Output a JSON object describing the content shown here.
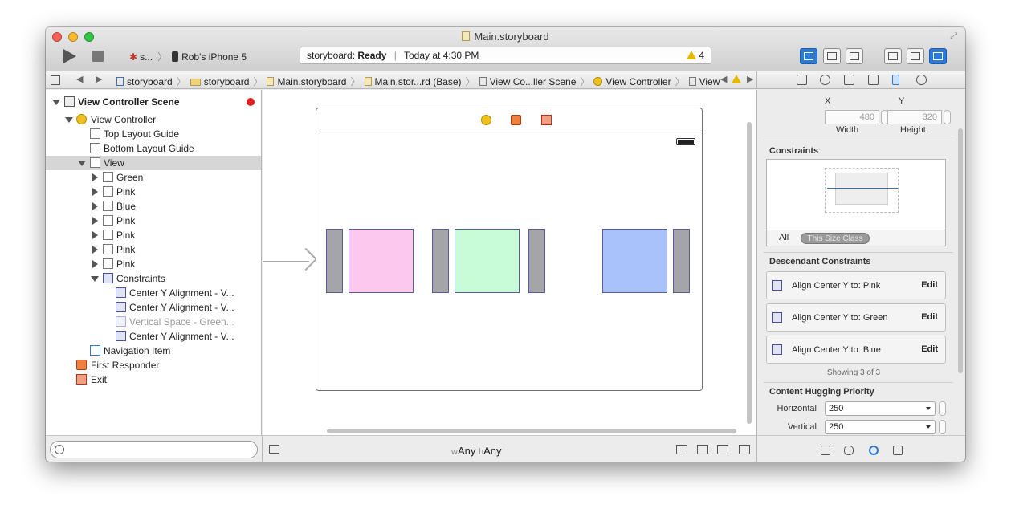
{
  "window": {
    "title": "Main.storyboard"
  },
  "toolbar": {
    "scheme_app": "s...",
    "scheme_device": "Rob's iPhone 5",
    "activity_prefix": "storyboard:",
    "activity_status": "Ready",
    "activity_time": "Today at 4:30 PM",
    "warning_count": "4"
  },
  "jumpbar": {
    "crumbs": [
      "storyboard",
      "storyboard",
      "Main.storyboard",
      "Main.stor...rd (Base)",
      "View Co...ller Scene",
      "View Controller",
      "View"
    ]
  },
  "outline": {
    "rows": [
      {
        "label": "View Controller Scene"
      },
      {
        "label": "View Controller"
      },
      {
        "label": "Top Layout Guide"
      },
      {
        "label": "Bottom Layout Guide"
      },
      {
        "label": "View"
      },
      {
        "label": "Green"
      },
      {
        "label": "Pink"
      },
      {
        "label": "Blue"
      },
      {
        "label": "Pink"
      },
      {
        "label": "Pink"
      },
      {
        "label": "Pink"
      },
      {
        "label": "Pink"
      },
      {
        "label": "Constraints"
      },
      {
        "label": "Center Y Alignment - V..."
      },
      {
        "label": "Center Y Alignment - V..."
      },
      {
        "label": "Vertical Space - Green..."
      },
      {
        "label": "Center Y Alignment - V..."
      },
      {
        "label": "Navigation Item"
      },
      {
        "label": "First Responder"
      },
      {
        "label": "Exit"
      }
    ]
  },
  "canvas": {
    "size_class_w": "w",
    "size_class_w_value": "Any",
    "size_class_h": "h",
    "size_class_h_value": "Any"
  },
  "colors": {
    "pink": "#fdc8ee",
    "green": "#c8fcd9",
    "blue": "#a9c2fb",
    "gray": "#a5a5a9"
  },
  "inspector": {
    "x_label": "X",
    "y_label": "Y",
    "width_value": "480",
    "height_value": "320",
    "width_label": "Width",
    "height_label": "Height",
    "constraints_title": "Constraints",
    "all_label": "All",
    "size_class_pill": "This Size Class",
    "descendant_title": "Descendant Constraints",
    "descendant": [
      {
        "text": "Align Center Y to:  Pink",
        "edit": "Edit"
      },
      {
        "text": "Align Center Y to:  Green",
        "edit": "Edit"
      },
      {
        "text": "Align Center Y to:  Blue",
        "edit": "Edit"
      }
    ],
    "showing": "Showing 3 of 3",
    "hugging_title": "Content Hugging Priority",
    "horizontal_label": "Horizontal",
    "horizontal_value": "250",
    "vertical_label": "Vertical",
    "vertical_value": "250"
  }
}
